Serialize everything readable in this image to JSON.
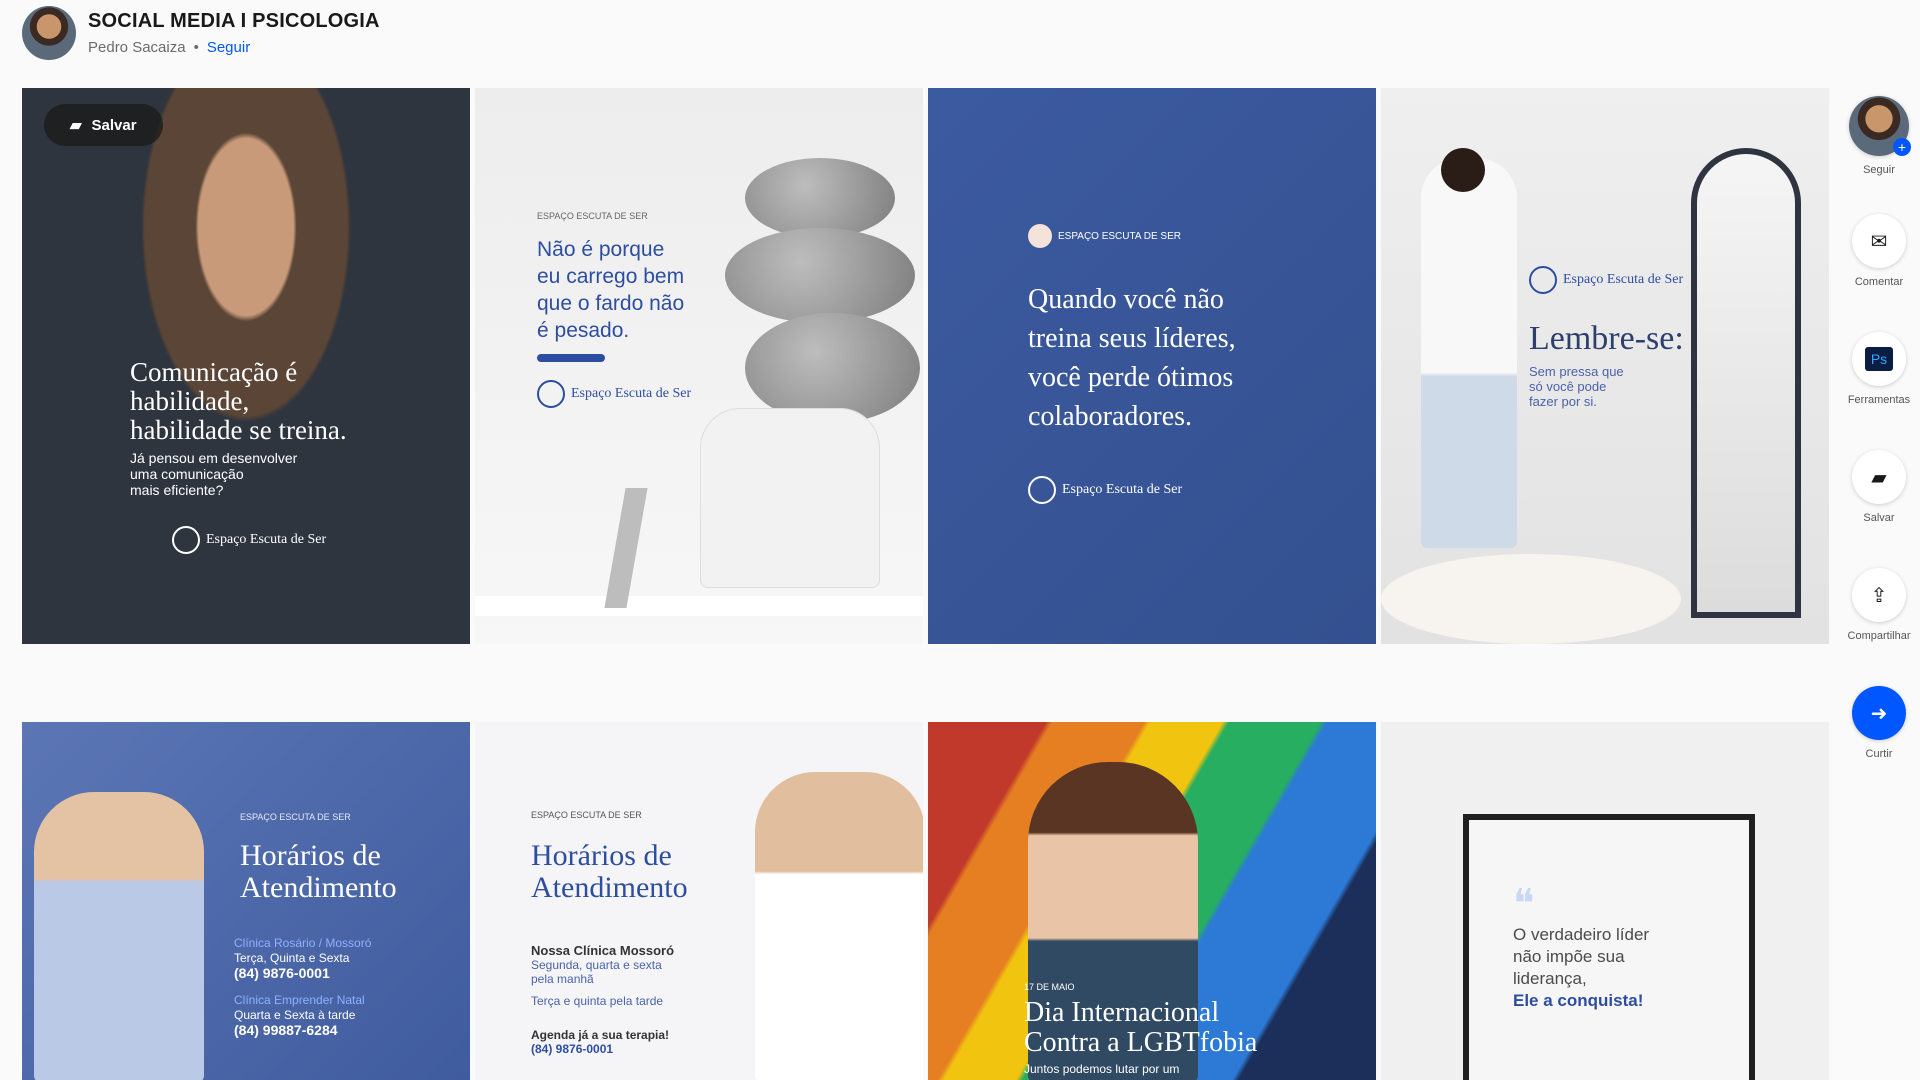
{
  "header": {
    "title": "SOCIAL MEDIA I PSICOLOGIA",
    "owner": "Pedro Sacaiza",
    "separator": "•",
    "follow": "Seguir"
  },
  "grid": {
    "save_label": "Salvar",
    "cards": [
      {
        "lines": [
          "Comunicação é",
          "habilidade,",
          "habilidade se treina."
        ],
        "sub": [
          "Já pensou em desenvolver",
          "uma comunicação",
          "mais eficiente?"
        ],
        "brand": "Espaço Escuta de Ser"
      },
      {
        "kicker": "ESPAÇO ESCUTA DE SER",
        "lines": [
          "Não é porque",
          "eu carrego bem",
          "que o fardo não",
          "é pesado."
        ],
        "brand": "Espaço Escuta de Ser"
      },
      {
        "handle": "ESPAÇO ESCUTA DE SER",
        "lines": [
          "Quando você não",
          "treina seus líderes,",
          "você perde ótimos",
          "colaboradores."
        ],
        "brand": "Espaço Escuta de Ser"
      },
      {
        "brand": "Espaço Escuta de Ser",
        "lines": [
          "Lembre-se:"
        ],
        "sub": [
          "Sem pressa que",
          "só você pode",
          "fazer por si."
        ]
      },
      {
        "kicker": "ESPAÇO ESCUTA DE SER",
        "lines": [
          "Horários de",
          "Atendimento"
        ],
        "items": [
          "Clínica Rosário / Mossoró",
          "Terça, Quinta e Sexta",
          "(84) 9876-0001",
          "Clínica Emprender Natal",
          "Quarta e Sexta à tarde",
          "(84) 99887-6284"
        ]
      },
      {
        "kicker": "ESPAÇO ESCUTA DE SER",
        "lines": [
          "Horários de",
          "Atendimento"
        ],
        "items": [
          "Nossa Clínica Mossoró",
          "Segunda, quarta e sexta",
          "pela manhã",
          "Terça e quinta pela tarde",
          "Agenda já a sua terapia!",
          "(84) 9876-0001"
        ]
      },
      {
        "kicker": "17 DE MAIO",
        "lines": [
          "Dia Internacional",
          "Contra a LGBTfobia"
        ],
        "sub": [
          "Juntos podemos lutar por um"
        ]
      },
      {
        "quote": [
          "O verdadeiro líder",
          "não impõe sua",
          "liderança,"
        ],
        "quote_em": "Ele a conquista!"
      }
    ]
  },
  "rail": [
    {
      "label": "Seguir",
      "icon": "avatar"
    },
    {
      "label": "Comentar",
      "icon": "✉"
    },
    {
      "label": "Ferramentas",
      "icon": "Ps"
    },
    {
      "label": "Salvar",
      "icon": "▰"
    },
    {
      "label": "Compartilhar",
      "icon": "⇪"
    },
    {
      "label": "Curtir",
      "icon": "➜"
    }
  ],
  "colors": {
    "accent": "#0057ff",
    "navy": "#2d4ea0",
    "dark": "#191919"
  }
}
